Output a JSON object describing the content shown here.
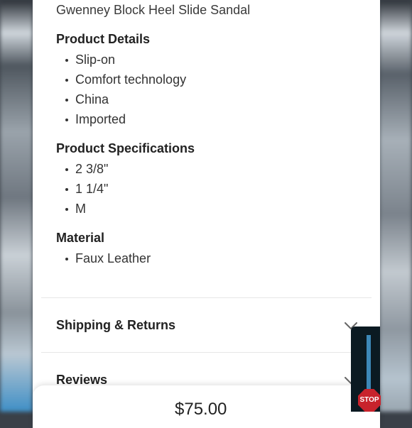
{
  "product": {
    "title": "Gwenney Block Heel Slide Sandal"
  },
  "sections": {
    "details": {
      "heading": "Product Details",
      "items": [
        "Slip-on",
        "Comfort technology",
        "China",
        "Imported"
      ]
    },
    "specs": {
      "heading": "Product Specifications",
      "items": [
        "2 3/8\"",
        "1 1/4\"",
        "M"
      ]
    },
    "material": {
      "heading": "Material",
      "items": [
        "Faux Leather"
      ]
    }
  },
  "accordions": {
    "shipping": {
      "label": "Shipping & Returns",
      "icon": "chevron-down-icon"
    },
    "reviews": {
      "label": "Reviews",
      "icon": "chevron-down-icon"
    }
  },
  "footer": {
    "price": "$75.00"
  },
  "overlay": {
    "stop_text": "STOP"
  },
  "colors": {
    "background": "#ffffff",
    "text": "#222222",
    "divider": "#e6e6e6",
    "chevron": "#666666"
  }
}
